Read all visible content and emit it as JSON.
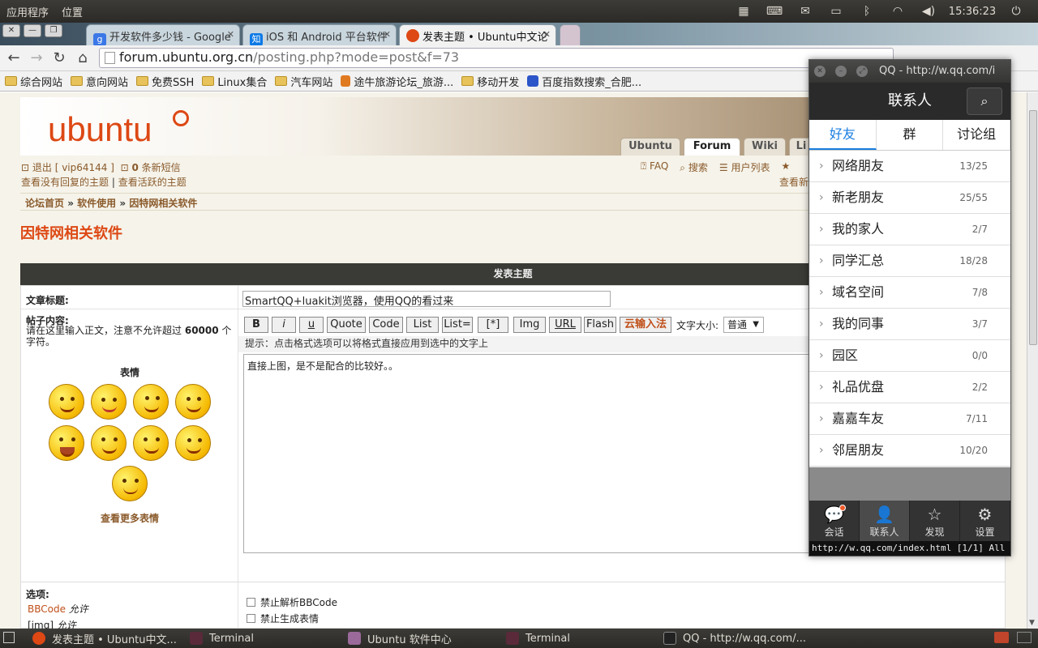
{
  "system_bar": {
    "menus": [
      "应用程序",
      "位置"
    ],
    "clock": "15:36:23"
  },
  "browser": {
    "tabs": [
      {
        "favicon": "g",
        "title": "开发软件多少钱 - Google",
        "active": false
      },
      {
        "favicon": "知",
        "title": "iOS 和 Android 平台软件",
        "active": false
      },
      {
        "favicon": "ubuntu",
        "title": "发表主题 • Ubuntu中文论",
        "active": true
      }
    ],
    "url_host": "forum.ubuntu.org.cn",
    "url_path": "/posting.php?mode=post&f=73",
    "bookmarks": [
      "综合网站",
      "意向网站",
      "免费SSH",
      "Linux集合",
      "汽车网站",
      "途牛旅游论坛_旅游...",
      "移动开发",
      "百度指数搜索_合肥..."
    ]
  },
  "forum": {
    "logo_text": "ubuntu",
    "site_tabs": [
      "Ubuntu",
      "Forum",
      "Wiki",
      "Li"
    ],
    "user_line": "退出 [ vip64144 ]",
    "pm_count": "0",
    "pm_label": "条新短信",
    "unanswered": "查看没有回复的主题",
    "active_topics": "查看活跃的主题",
    "right_links": [
      "FAQ",
      "搜索",
      "用户列表"
    ],
    "right_link_cut": "查看新",
    "breadcrumb": [
      "论坛首页",
      "软件使用",
      "因特网相关软件"
    ],
    "forum_title": "因特网相关软件",
    "form_header": "发表主题",
    "subject_label": "文章标题:",
    "subject_value": "SmartQQ+luakit浏览器，使用QQ的看过来",
    "content_label": "帖子内容:",
    "content_hint_pre": "请在这里输入正文，注意不允许超过",
    "content_hint_num": "60000",
    "content_hint_post": "个字符。",
    "smilies_label": "表情",
    "more_smilies": "查看更多表情",
    "bbcode_buttons": [
      "B",
      "i",
      "u",
      "Quote",
      "Code",
      "List",
      "List=",
      "[*]",
      "Img",
      "URL",
      "Flash",
      "云输入法"
    ],
    "font_size_label": "文字大小:",
    "font_size_value": "普通",
    "format_tip": "提示：点击格式选项可以将格式直接应用到选中的文字上",
    "post_body": "直接上图，是不是配合的比较好。。",
    "options_label": "选项:",
    "bbcode_status": "BBCode",
    "allowed": "允许",
    "img_status": "[img]",
    "disable_bbcode": "禁止解析BBCode",
    "disable_smilies": "禁止生成表情"
  },
  "qq_window": {
    "title": "QQ - http://w.qq.com/i",
    "header": "联系人",
    "tabs": [
      "好友",
      "群",
      "讨论组"
    ],
    "groups": [
      {
        "name": "网络朋友",
        "count": "13/25"
      },
      {
        "name": "新老朋友",
        "count": "25/55"
      },
      {
        "name": "我的家人",
        "count": "2/7"
      },
      {
        "name": "同学汇总",
        "count": "18/28"
      },
      {
        "name": "域名空间",
        "count": "7/8"
      },
      {
        "name": "我的同事",
        "count": "3/7"
      },
      {
        "name": "园区",
        "count": "0/0"
      },
      {
        "name": "礼品优盘",
        "count": "2/2"
      },
      {
        "name": "嘉嘉车友",
        "count": "7/11"
      },
      {
        "name": "邻居朋友",
        "count": "10/20"
      }
    ],
    "bottom_nav": [
      "会话",
      "联系人",
      "发现",
      "设置"
    ],
    "status_line": "http://w.qq.com/index.html [1/1] All"
  },
  "taskbar": {
    "items": [
      "发表主题 • Ubuntu中文...",
      "Terminal",
      "Ubuntu 软件中心",
      "Terminal",
      "QQ - http://w.qq.com/..."
    ]
  },
  "colors": {
    "ubuntu_orange": "#dd4814",
    "qq_blue": "#1a7de0",
    "link_brown": "#8a5a2b"
  }
}
